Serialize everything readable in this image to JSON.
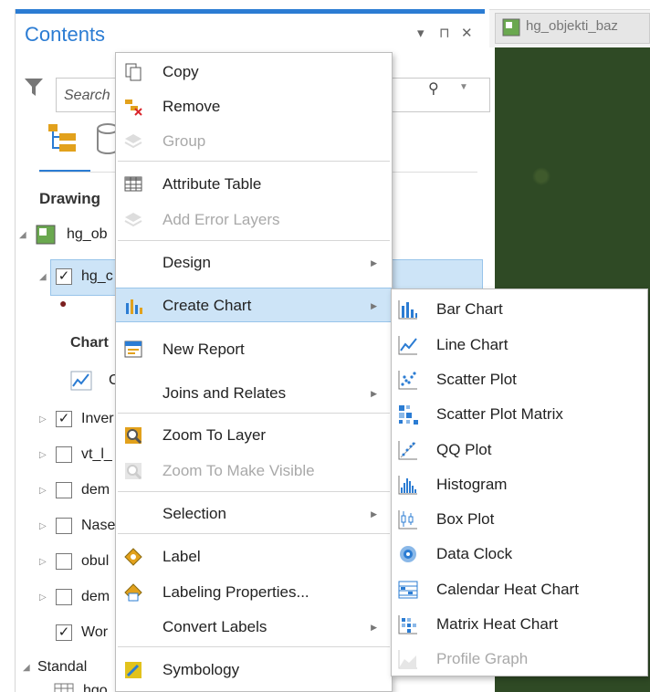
{
  "contents": {
    "title": "Contents",
    "controls": [
      "▾",
      "⊓",
      "✕"
    ],
    "search_placeholder": "Search",
    "drawing_order": "Drawing",
    "tree": {
      "map_layer": "hg_ob",
      "selected_layer": "hg_c",
      "chart_heading": "Chart",
      "chart_item": "C",
      "rows": [
        "Inver",
        "vt_l_",
        "dem",
        "Nase",
        "obul",
        "dem",
        "Wor"
      ],
      "standalone": "Standal",
      "table_item": "hgo"
    }
  },
  "map": {
    "tab_label": "hg_objekti_baz"
  },
  "context_menu": {
    "items": [
      {
        "label": "Copy",
        "icon": "copy-icon",
        "enabled": true
      },
      {
        "label": "Remove",
        "icon": "remove-icon",
        "enabled": true
      },
      {
        "label": "Group",
        "icon": "group-icon",
        "enabled": false
      },
      {
        "label": "Attribute Table",
        "icon": "table-icon",
        "enabled": true
      },
      {
        "label": "Add Error Layers",
        "icon": "error-layers-icon",
        "enabled": false
      },
      {
        "label": "Design",
        "icon": "",
        "enabled": true,
        "submenu": true
      },
      {
        "label": "Create Chart",
        "icon": "chart-icon",
        "enabled": true,
        "submenu": true,
        "active": true
      },
      {
        "label": "New Report",
        "icon": "report-icon",
        "enabled": true
      },
      {
        "label": "Joins and Relates",
        "icon": "",
        "enabled": true,
        "submenu": true
      },
      {
        "label": "Zoom To Layer",
        "icon": "zoom-layer-icon",
        "enabled": true
      },
      {
        "label": "Zoom To Make Visible",
        "icon": "zoom-visible-icon",
        "enabled": false
      },
      {
        "label": "Selection",
        "icon": "",
        "enabled": true,
        "submenu": true
      },
      {
        "label": "Label",
        "icon": "label-icon",
        "enabled": true
      },
      {
        "label": "Labeling Properties...",
        "icon": "labeling-properties-icon",
        "enabled": true
      },
      {
        "label": "Convert Labels",
        "icon": "",
        "enabled": true,
        "submenu": true
      },
      {
        "label": "Symbology",
        "icon": "symbology-icon",
        "enabled": true
      }
    ]
  },
  "chart_submenu": {
    "items": [
      {
        "label": "Bar Chart",
        "icon": "bar-chart-icon",
        "enabled": true
      },
      {
        "label": "Line Chart",
        "icon": "line-chart-icon",
        "enabled": true
      },
      {
        "label": "Scatter Plot",
        "icon": "scatter-plot-icon",
        "enabled": true
      },
      {
        "label": "Scatter Plot Matrix",
        "icon": "scatter-matrix-icon",
        "enabled": true
      },
      {
        "label": "QQ Plot",
        "icon": "qq-plot-icon",
        "enabled": true
      },
      {
        "label": "Histogram",
        "icon": "histogram-icon",
        "enabled": true
      },
      {
        "label": "Box Plot",
        "icon": "box-plot-icon",
        "enabled": true
      },
      {
        "label": "Data Clock",
        "icon": "data-clock-icon",
        "enabled": true
      },
      {
        "label": "Calendar Heat Chart",
        "icon": "calendar-heat-icon",
        "enabled": true
      },
      {
        "label": "Matrix Heat Chart",
        "icon": "matrix-heat-icon",
        "enabled": true
      },
      {
        "label": "Profile Graph",
        "icon": "profile-graph-icon",
        "enabled": false
      }
    ]
  },
  "colors": {
    "accent": "#2b7cd3",
    "highlight": "#cde4f7",
    "disabled_text": "#a9a9a9"
  }
}
